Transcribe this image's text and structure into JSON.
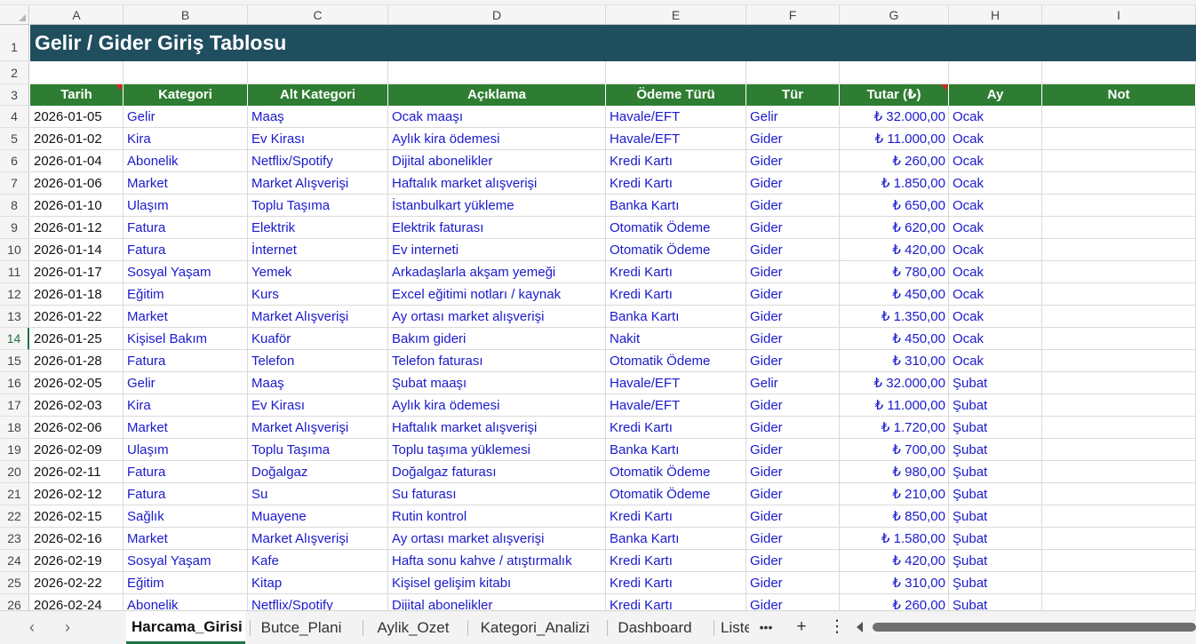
{
  "columns": [
    "A",
    "B",
    "C",
    "D",
    "E",
    "F",
    "G",
    "H",
    "I"
  ],
  "row_numbers": [
    "1",
    "2",
    "3",
    "4",
    "5",
    "6",
    "7",
    "8",
    "9",
    "10",
    "11",
    "12",
    "13",
    "14",
    "15",
    "16",
    "17",
    "18",
    "19",
    "20",
    "21",
    "22",
    "23",
    "24",
    "25",
    "26"
  ],
  "selected_row": "14",
  "title": "Gelir / Gider Giriş Tablosu",
  "headers": [
    "Tarih",
    "Kategori",
    "Alt Kategori",
    "Açıklama",
    "Ödeme Türü",
    "Tür",
    "Tutar (₺)",
    "Ay",
    "Not"
  ],
  "rows": [
    [
      "2026-01-05",
      "Gelir",
      "Maaş",
      "Ocak maaşı",
      "Havale/EFT",
      "Gelir",
      "₺ 32.000,00",
      "Ocak",
      ""
    ],
    [
      "2026-01-02",
      "Kira",
      "Ev Kirası",
      "Aylık kira ödemesi",
      "Havale/EFT",
      "Gider",
      "₺ 11.000,00",
      "Ocak",
      ""
    ],
    [
      "2026-01-04",
      "Abonelik",
      "Netflix/Spotify",
      "Dijital abonelikler",
      "Kredi Kartı",
      "Gider",
      "₺ 260,00",
      "Ocak",
      ""
    ],
    [
      "2026-01-06",
      "Market",
      "Market Alışverişi",
      "Haftalık market alışverişi",
      "Kredi Kartı",
      "Gider",
      "₺ 1.850,00",
      "Ocak",
      ""
    ],
    [
      "2026-01-10",
      "Ulaşım",
      "Toplu Taşıma",
      "İstanbulkart yükleme",
      "Banka Kartı",
      "Gider",
      "₺ 650,00",
      "Ocak",
      ""
    ],
    [
      "2026-01-12",
      "Fatura",
      "Elektrik",
      "Elektrik faturası",
      "Otomatik Ödeme",
      "Gider",
      "₺ 620,00",
      "Ocak",
      ""
    ],
    [
      "2026-01-14",
      "Fatura",
      "İnternet",
      "Ev interneti",
      "Otomatik Ödeme",
      "Gider",
      "₺ 420,00",
      "Ocak",
      ""
    ],
    [
      "2026-01-17",
      "Sosyal Yaşam",
      "Yemek",
      "Arkadaşlarla akşam yemeği",
      "Kredi Kartı",
      "Gider",
      "₺ 780,00",
      "Ocak",
      ""
    ],
    [
      "2026-01-18",
      "Eğitim",
      "Kurs",
      "Excel eğitimi notları / kaynak",
      "Kredi Kartı",
      "Gider",
      "₺ 450,00",
      "Ocak",
      ""
    ],
    [
      "2026-01-22",
      "Market",
      "Market Alışverişi",
      "Ay ortası market alışverişi",
      "Banka Kartı",
      "Gider",
      "₺ 1.350,00",
      "Ocak",
      ""
    ],
    [
      "2026-01-25",
      "Kişisel Bakım",
      "Kuaför",
      "Bakım gideri",
      "Nakit",
      "Gider",
      "₺ 450,00",
      "Ocak",
      ""
    ],
    [
      "2026-01-28",
      "Fatura",
      "Telefon",
      "Telefon faturası",
      "Otomatik Ödeme",
      "Gider",
      "₺ 310,00",
      "Ocak",
      ""
    ],
    [
      "2026-02-05",
      "Gelir",
      "Maaş",
      "Şubat maaşı",
      "Havale/EFT",
      "Gelir",
      "₺ 32.000,00",
      "Şubat",
      ""
    ],
    [
      "2026-02-03",
      "Kira",
      "Ev Kirası",
      "Aylık kira ödemesi",
      "Havale/EFT",
      "Gider",
      "₺ 11.000,00",
      "Şubat",
      ""
    ],
    [
      "2026-02-06",
      "Market",
      "Market Alışverişi",
      "Haftalık market alışverişi",
      "Kredi Kartı",
      "Gider",
      "₺ 1.720,00",
      "Şubat",
      ""
    ],
    [
      "2026-02-09",
      "Ulaşım",
      "Toplu Taşıma",
      "Toplu taşıma yüklemesi",
      "Banka Kartı",
      "Gider",
      "₺ 700,00",
      "Şubat",
      ""
    ],
    [
      "2026-02-11",
      "Fatura",
      "Doğalgaz",
      "Doğalgaz faturası",
      "Otomatik Ödeme",
      "Gider",
      "₺ 980,00",
      "Şubat",
      ""
    ],
    [
      "2026-02-12",
      "Fatura",
      "Su",
      "Su faturası",
      "Otomatik Ödeme",
      "Gider",
      "₺ 210,00",
      "Şubat",
      ""
    ],
    [
      "2026-02-15",
      "Sağlık",
      "Muayene",
      "Rutin kontrol",
      "Kredi Kartı",
      "Gider",
      "₺ 850,00",
      "Şubat",
      ""
    ],
    [
      "2026-02-16",
      "Market",
      "Market Alışverişi",
      "Ay ortası market alışverişi",
      "Banka Kartı",
      "Gider",
      "₺ 1.580,00",
      "Şubat",
      ""
    ],
    [
      "2026-02-19",
      "Sosyal Yaşam",
      "Kafe",
      "Hafta sonu kahve / atıştırmalık",
      "Kredi Kartı",
      "Gider",
      "₺ 420,00",
      "Şubat",
      ""
    ],
    [
      "2026-02-22",
      "Eğitim",
      "Kitap",
      "Kişisel gelişim kitabı",
      "Kredi Kartı",
      "Gider",
      "₺ 310,00",
      "Şubat",
      ""
    ],
    [
      "2026-02-24",
      "Abonelik",
      "Netflix/Spotify",
      "Dijital abonelikler",
      "Kredi Kartı",
      "Gider",
      "₺ 260,00",
      "Şubat",
      ""
    ]
  ],
  "sheet_tabs": [
    {
      "label": "Harcama_Girisi",
      "active": true
    },
    {
      "label": "Butce_Plani",
      "active": false
    },
    {
      "label": "Aylik_Ozet",
      "active": false
    },
    {
      "label": "Kategori_Analizi",
      "active": false
    },
    {
      "label": "Dashboard",
      "active": false
    },
    {
      "label": "Liste",
      "active": false
    }
  ],
  "tab_nav": {
    "prev": "‹",
    "next": "›",
    "more": "•••",
    "add": "+",
    "menu": "⋮"
  },
  "colors": {
    "title_bg": "#1f4e5f",
    "header_bg": "#2e7d32",
    "data_text": "#1a1acc",
    "accent": "#217346"
  }
}
